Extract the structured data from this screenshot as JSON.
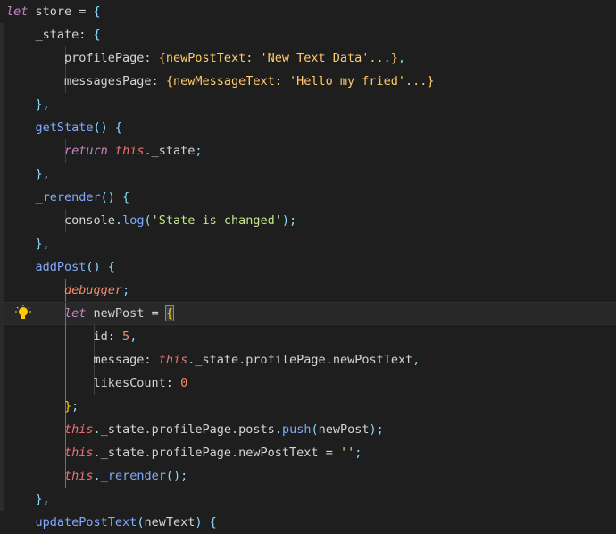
{
  "editor": {
    "lines": [
      [
        [
          "kw-italic",
          "let"
        ],
        [
          "plain",
          " store = "
        ],
        [
          "punc",
          "{"
        ]
      ],
      [
        [
          "plain",
          "    _state: "
        ],
        [
          "punc",
          "{"
        ]
      ],
      [
        [
          "plain",
          "        profilePage: "
        ],
        [
          "strY",
          "{newPostText: 'New Text Data'...}"
        ],
        [
          "punc",
          ","
        ]
      ],
      [
        [
          "plain",
          "        messagesPage: "
        ],
        [
          "strY",
          "{newMessageText: 'Hello my fried'...}"
        ]
      ],
      [
        [
          "plain",
          "    "
        ],
        [
          "punc",
          "},"
        ]
      ],
      [
        [
          "plain",
          "    "
        ],
        [
          "fn",
          "getState"
        ],
        [
          "punc",
          "() {"
        ]
      ],
      [
        [
          "plain",
          "        "
        ],
        [
          "kw-italic",
          "return "
        ],
        [
          "this",
          "this"
        ],
        [
          "punc",
          "."
        ],
        [
          "plain",
          "_state"
        ],
        [
          "punc",
          ";"
        ]
      ],
      [
        [
          "plain",
          "    "
        ],
        [
          "punc",
          "},"
        ]
      ],
      [
        [
          "plain",
          "    "
        ],
        [
          "fn",
          "_rerender"
        ],
        [
          "punc",
          "() {"
        ]
      ],
      [
        [
          "plain",
          "        console"
        ],
        [
          "punc",
          "."
        ],
        [
          "fn",
          "log"
        ],
        [
          "punc",
          "("
        ],
        [
          "str",
          "'State is changed'"
        ],
        [
          "punc",
          ");"
        ]
      ],
      [
        [
          "plain",
          "    "
        ],
        [
          "punc",
          "},"
        ]
      ],
      [
        [
          "plain",
          "    "
        ],
        [
          "fn",
          "addPost"
        ],
        [
          "punc",
          "() {"
        ]
      ],
      [
        [
          "plain",
          "        "
        ],
        [
          "dbg",
          "debugger"
        ],
        [
          "punc",
          ";"
        ]
      ],
      [
        [
          "plain",
          "        "
        ],
        [
          "kw-italic",
          "let "
        ],
        [
          "plain",
          "newPost = "
        ],
        [
          "brace-y",
          "{"
        ]
      ],
      [
        [
          "plain",
          "            id: "
        ],
        [
          "num",
          "5"
        ],
        [
          "punc",
          ","
        ]
      ],
      [
        [
          "plain",
          "            message: "
        ],
        [
          "this",
          "this"
        ],
        [
          "punc",
          "."
        ],
        [
          "plain",
          "_state"
        ],
        [
          "punc",
          "."
        ],
        [
          "plain",
          "profilePage"
        ],
        [
          "punc",
          "."
        ],
        [
          "plain",
          "newPostText"
        ],
        [
          "punc",
          ","
        ]
      ],
      [
        [
          "plain",
          "            likesCount: "
        ],
        [
          "num",
          "0"
        ]
      ],
      [
        [
          "plain",
          "        "
        ],
        [
          "brace-y",
          "}"
        ],
        [
          "punc",
          ";"
        ]
      ],
      [
        [
          "plain",
          "        "
        ],
        [
          "this",
          "this"
        ],
        [
          "punc",
          "."
        ],
        [
          "plain",
          "_state"
        ],
        [
          "punc",
          "."
        ],
        [
          "plain",
          "profilePage"
        ],
        [
          "punc",
          "."
        ],
        [
          "plain",
          "posts"
        ],
        [
          "punc",
          "."
        ],
        [
          "fn",
          "push"
        ],
        [
          "punc",
          "("
        ],
        [
          "plain",
          "newPost"
        ],
        [
          "punc",
          ");"
        ]
      ],
      [
        [
          "plain",
          "        "
        ],
        [
          "this",
          "this"
        ],
        [
          "punc",
          "."
        ],
        [
          "plain",
          "_state"
        ],
        [
          "punc",
          "."
        ],
        [
          "plain",
          "profilePage"
        ],
        [
          "punc",
          "."
        ],
        [
          "plain",
          "newPostText = "
        ],
        [
          "str",
          "''"
        ],
        [
          "punc",
          ";"
        ]
      ],
      [
        [
          "plain",
          "        "
        ],
        [
          "this",
          "this"
        ],
        [
          "punc",
          "."
        ],
        [
          "fn",
          "_rerender"
        ],
        [
          "punc",
          "();"
        ]
      ],
      [
        [
          "plain",
          "    "
        ],
        [
          "punc",
          "},"
        ]
      ],
      [
        [
          "plain",
          "    "
        ],
        [
          "fn",
          "updatePostText"
        ],
        [
          "punc",
          "("
        ],
        [
          "plain",
          "newText"
        ],
        [
          "punc",
          ") {"
        ]
      ]
    ],
    "lightbulb_icon": "lightbulb-icon"
  }
}
